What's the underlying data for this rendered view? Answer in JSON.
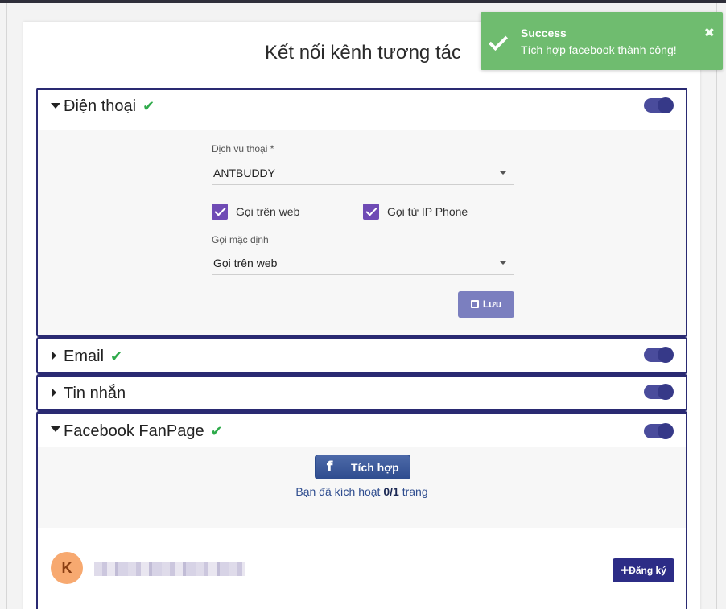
{
  "page": {
    "title": "Kết nối kênh tương tác"
  },
  "toast": {
    "title": "Success",
    "message": "Tích hợp facebook thành công!",
    "close": "✖"
  },
  "panels": {
    "phone": {
      "title": "Điện thoại",
      "verified": true,
      "enabled": true,
      "service_label": "Dịch vụ thoại *",
      "service_value": "ANTBUDDY",
      "checkbox_web": "Gọi trên web",
      "checkbox_ip": "Gọi từ IP Phone",
      "default_label": "Gọi mặc định",
      "default_value": "Gọi trên web",
      "save_label": "Lưu"
    },
    "email": {
      "title": "Email",
      "verified": true,
      "enabled": true
    },
    "sms": {
      "title": "Tin nhắn",
      "enabled": true
    },
    "facebook": {
      "title": "Facebook FanPage",
      "verified": true,
      "enabled": true,
      "integrate_label": "Tích hợp",
      "note_prefix": "Bạn đã kích hoạt ",
      "note_count": "0/1",
      "note_suffix": " trang",
      "avatar_letter": "K",
      "register_label": "Đăng ký"
    }
  },
  "colors": {
    "accent": "#2a2a72",
    "toggle": "#363988",
    "success": "#6fbc6f",
    "facebook": "#3b5998"
  }
}
